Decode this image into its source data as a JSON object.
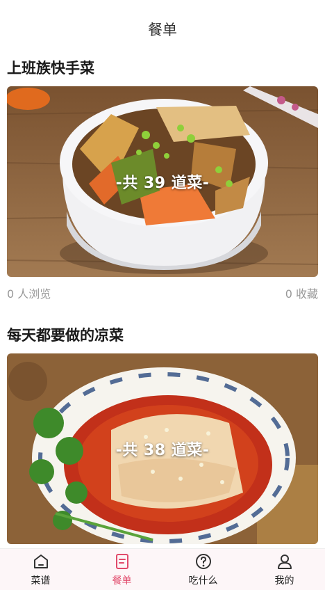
{
  "header": {
    "title": "餐单"
  },
  "menus": [
    {
      "title": "上班族快手菜",
      "count_label": "-共 39 道菜-",
      "views": "0 人浏览",
      "favorites": "0 收藏"
    },
    {
      "title": "每天都要做的凉菜",
      "count_label": "-共 38 道菜-"
    }
  ],
  "tabbar": {
    "items": [
      {
        "label": "菜谱",
        "icon": "home-icon",
        "active": false
      },
      {
        "label": "餐单",
        "icon": "menu-list-icon",
        "active": true
      },
      {
        "label": "吃什么",
        "icon": "question-icon",
        "active": false
      },
      {
        "label": "我的",
        "icon": "profile-icon",
        "active": false
      }
    ],
    "active_color": "#e14a6b"
  }
}
